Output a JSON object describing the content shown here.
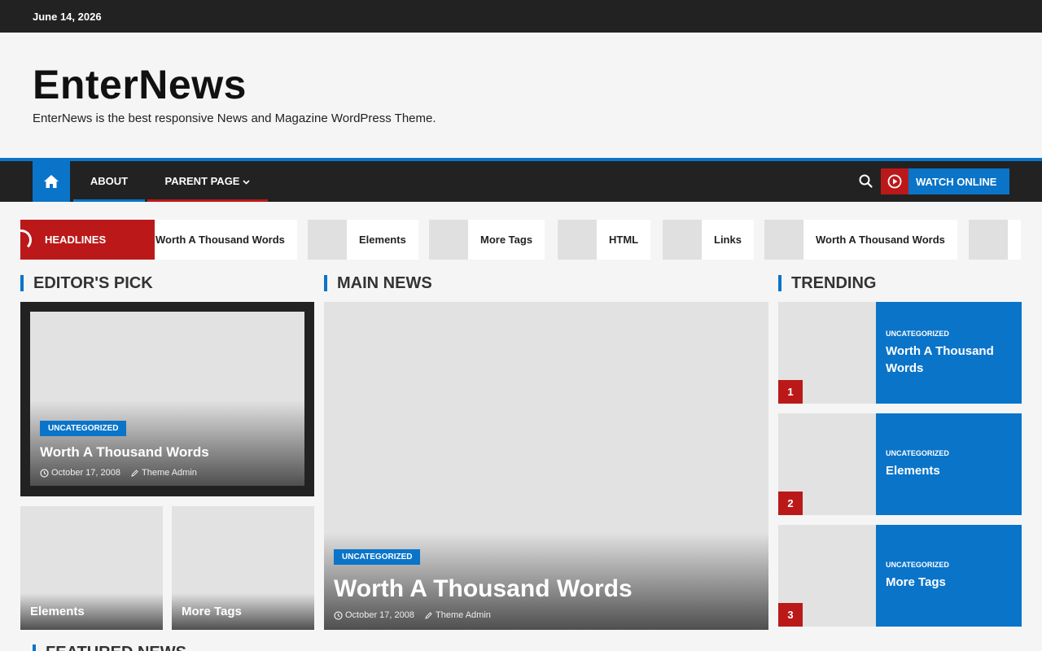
{
  "topbar": {
    "date": "June 14, 2026"
  },
  "site": {
    "title": "EnterNews",
    "description": "EnterNews is the best responsive News and Magazine WordPress Theme."
  },
  "nav": {
    "items": [
      "ABOUT",
      "PARENT PAGE"
    ],
    "watch_label": "WATCH ONLINE"
  },
  "ticker": {
    "label": "HEADLINES",
    "items": [
      "Worth A Thousand Words",
      "Elements",
      "More Tags",
      "HTML",
      "Links",
      "Worth A Thousand Words"
    ]
  },
  "sections": {
    "editors_pick": "EDITOR'S PICK",
    "main_news": "MAIN NEWS",
    "trending": "TRENDING",
    "featured": "FEATURED NEWS"
  },
  "editors_pick": {
    "main": {
      "category": "UNCATEGORIZED",
      "title": "Worth A Thousand Words",
      "date": "October 17, 2008",
      "author": "Theme Admin"
    },
    "small": [
      {
        "title": "Elements"
      },
      {
        "title": "More Tags"
      }
    ]
  },
  "main_news": {
    "category": "UNCATEGORIZED",
    "title": "Worth A Thousand Words",
    "date": "October 17, 2008",
    "author": "Theme Admin"
  },
  "trending": [
    {
      "rank": "1",
      "category": "UNCATEGORIZED",
      "title": "Worth A Thousand Words"
    },
    {
      "rank": "2",
      "category": "UNCATEGORIZED",
      "title": "Elements"
    },
    {
      "rank": "3",
      "category": "UNCATEGORIZED",
      "title": "More Tags"
    }
  ],
  "colors": {
    "accent": "#0a74c9",
    "highlight": "#bb1919",
    "dark": "#222222"
  }
}
